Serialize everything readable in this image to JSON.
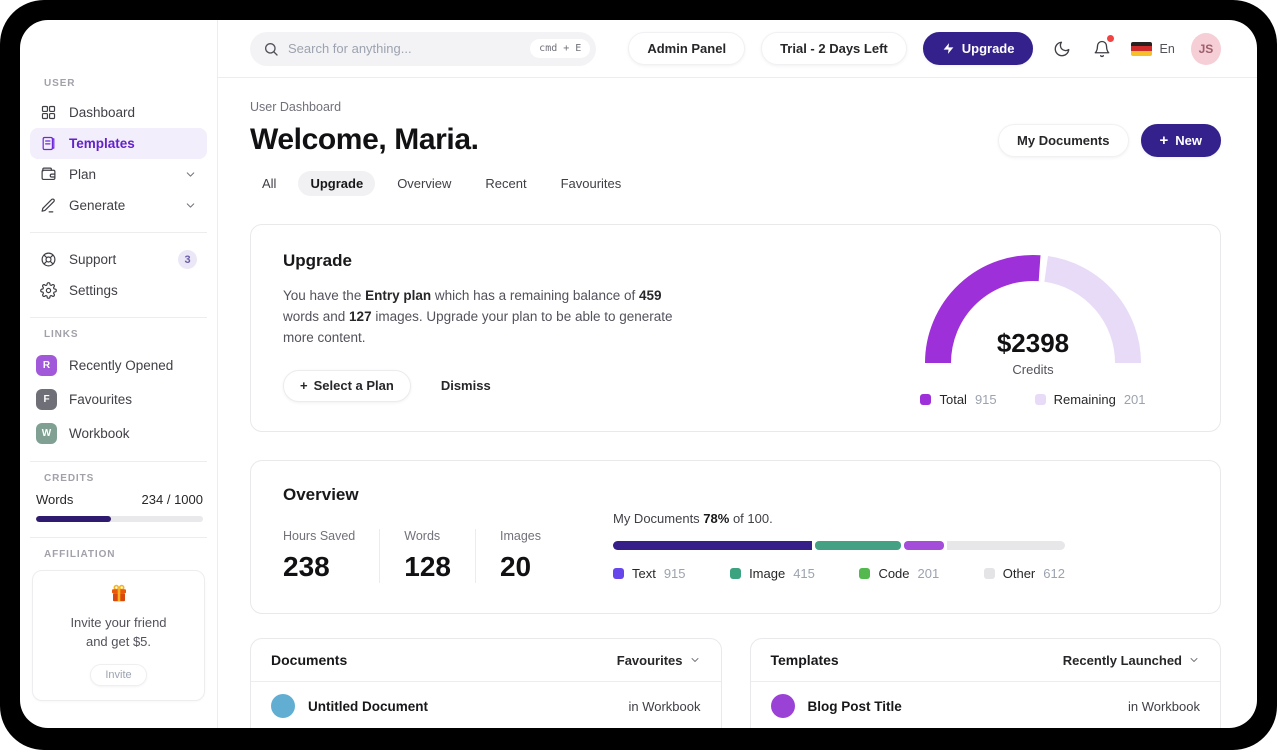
{
  "colors": {
    "primary_button": "#34218c",
    "sidebar_active": "#6223c7",
    "gauge_total": "#9e30d9",
    "gauge_remaining": "#e8dbf7",
    "credits_bar_fill": "#2e1a6e",
    "bar_text": "#371f8a",
    "bar_image": "#45a183",
    "bar_code": "#a44ddb",
    "bar_track": "#e7e7ea",
    "legend_text": "#6747ec",
    "legend_image": "#3ba37f",
    "legend_code": "#53b94e",
    "legend_other": "#e4e4e7",
    "notification_dot": "#ef4444",
    "avatar_bg": "#f6ced6"
  },
  "topbar": {
    "search_placeholder": "Search for anything...",
    "search_shortcut": "cmd + E",
    "admin_panel_label": "Admin Panel",
    "trial_label": "Trial - 2 Days Left",
    "upgrade_label": "Upgrade",
    "language_label": "En",
    "avatar_initials": "JS"
  },
  "sidebar": {
    "user_section_label": "USER",
    "nav": [
      {
        "label": "Dashboard"
      },
      {
        "label": "Templates",
        "active": true
      },
      {
        "label": "Plan",
        "expandable": true
      },
      {
        "label": "Generate",
        "expandable": true
      }
    ],
    "support_label": "Support",
    "support_badge": "3",
    "settings_label": "Settings",
    "links_section_label": "LINKS",
    "links": [
      {
        "initial": "R",
        "label": "Recently Opened",
        "color": "#a259d9"
      },
      {
        "initial": "F",
        "label": "Favourites",
        "color": "#6f6f78"
      },
      {
        "initial": "W",
        "label": "Workbook",
        "color": "#7fa093"
      }
    ],
    "credits_section_label": "CREDITS",
    "credits": {
      "label": "Words",
      "value": "234 / 1000",
      "percent_used": 45
    },
    "affiliation_section_label": "AFFILIATION",
    "affiliation": {
      "line1": "Invite your friend",
      "line2": "and get $5.",
      "button_label": "Invite"
    }
  },
  "header": {
    "breadcrumb": "User Dashboard",
    "title": "Welcome, Maria.",
    "my_documents_label": "My Documents",
    "new_label": "New",
    "tabs": [
      {
        "label": "All"
      },
      {
        "label": "Upgrade",
        "active": true
      },
      {
        "label": "Overview"
      },
      {
        "label": "Recent"
      },
      {
        "label": "Favourites"
      }
    ]
  },
  "upgrade_card": {
    "title": "Upgrade",
    "body_prefix": "You have the ",
    "plan_name": "Entry plan",
    "body_mid1": " which has a remaining balance of ",
    "words_value": "459",
    "body_mid2": " words and ",
    "images_value": "127",
    "body_suffix": " images. Upgrade your plan to be able to generate more content.",
    "select_plan_label": "Select a Plan",
    "dismiss_label": "Dismiss",
    "gauge": {
      "center_value": "$2398",
      "center_label": "Credits",
      "legend": [
        {
          "label": "Total",
          "value": "915"
        },
        {
          "label": "Remaining",
          "value": "201"
        }
      ]
    }
  },
  "overview_card": {
    "title": "Overview",
    "stats": [
      {
        "label": "Hours Saved",
        "value": "238"
      },
      {
        "label": "Words",
        "value": "128"
      },
      {
        "label": "Images",
        "value": "20"
      }
    ],
    "progress_prefix": "My Documents ",
    "progress_percent": "78%",
    "progress_suffix": " of 100.",
    "legend": [
      {
        "label": "Text",
        "value": "915"
      },
      {
        "label": "Image",
        "value": "415"
      },
      {
        "label": "Code",
        "value": "201"
      },
      {
        "label": "Other",
        "value": "612"
      }
    ]
  },
  "documents_card": {
    "title": "Documents",
    "filter_label": "Favourites",
    "rows": [
      {
        "title": "Untitled Document",
        "location": "in Workbook"
      }
    ]
  },
  "templates_card": {
    "title": "Templates",
    "filter_label": "Recently Launched",
    "rows": [
      {
        "title": "Blog Post Title",
        "location": "in Workbook"
      }
    ]
  },
  "chart_data": [
    {
      "type": "pie",
      "subtype": "half-donut-gauge",
      "title": "Credits gauge",
      "center_value": "$2398",
      "center_label": "Credits",
      "slices": [
        {
          "label": "Total",
          "value": 915,
          "color": "#9e30d9"
        },
        {
          "label": "Remaining",
          "value": 201,
          "color": "#e8dbf7"
        }
      ],
      "legend_position": "bottom"
    },
    {
      "type": "bar",
      "subtype": "stacked-progress",
      "title": "My Documents 78% of 100.",
      "categories": [
        "Text",
        "Image",
        "Code",
        "Other"
      ],
      "values": [
        915,
        415,
        201,
        612
      ],
      "segment_widths_pct": [
        44,
        19,
        9,
        28
      ],
      "colors": [
        "#371f8a",
        "#45a183",
        "#a44ddb",
        "#e7e7ea"
      ],
      "legend_position": "bottom"
    }
  ]
}
